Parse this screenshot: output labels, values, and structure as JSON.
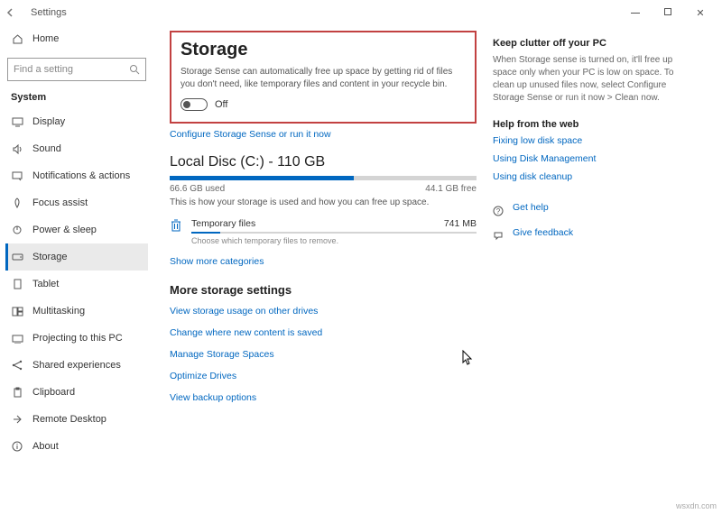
{
  "window": {
    "title": "Settings"
  },
  "home": {
    "label": "Home"
  },
  "search": {
    "placeholder": "Find a setting"
  },
  "section": {
    "label": "System"
  },
  "nav": [
    {
      "label": "Display"
    },
    {
      "label": "Sound"
    },
    {
      "label": "Notifications & actions"
    },
    {
      "label": "Focus assist"
    },
    {
      "label": "Power & sleep"
    },
    {
      "label": "Storage"
    },
    {
      "label": "Tablet"
    },
    {
      "label": "Multitasking"
    },
    {
      "label": "Projecting to this PC"
    },
    {
      "label": "Shared experiences"
    },
    {
      "label": "Clipboard"
    },
    {
      "label": "Remote Desktop"
    },
    {
      "label": "About"
    }
  ],
  "storage": {
    "heading": "Storage",
    "desc": "Storage Sense can automatically free up space by getting rid of files you don't need, like temporary files and content in your recycle bin.",
    "toggle_label": "Off",
    "configure_link": "Configure Storage Sense or run it now"
  },
  "disk": {
    "title": "Local Disc (C:) - 110 GB",
    "used": "66.6 GB used",
    "free": "44.1 GB free",
    "desc": "This is how your storage is used and how you can free up space.",
    "progress_pct": 60
  },
  "temp": {
    "name": "Temporary files",
    "size": "741 MB",
    "sub": "Choose which temporary files to remove."
  },
  "show_more": "Show more categories",
  "more_settings": {
    "heading": "More storage settings",
    "links": [
      "View storage usage on other drives",
      "Change where new content is saved",
      "Manage Storage Spaces",
      "Optimize Drives",
      "View backup options"
    ]
  },
  "right": {
    "box1": {
      "heading": "Keep clutter off your PC",
      "body": "When Storage sense is turned on, it'll free up space only when your PC is low on space. To clean up unused files now, select Configure Storage Sense or run it now > Clean now."
    },
    "box2": {
      "heading": "Help from the web",
      "links": [
        "Fixing low disk space",
        "Using Disk Management",
        "Using disk cleanup"
      ]
    },
    "help": {
      "label": "Get help"
    },
    "feedback": {
      "label": "Give feedback"
    }
  },
  "watermark": "wsxdn.com"
}
